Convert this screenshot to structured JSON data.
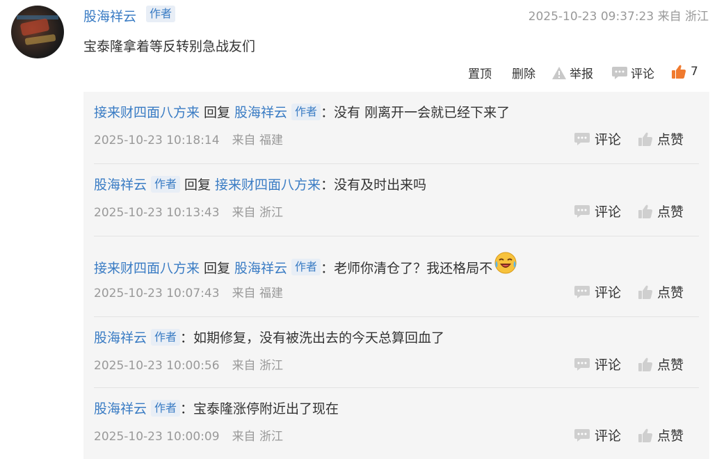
{
  "post": {
    "author": "股海祥云",
    "badge": "作者",
    "meta": "2025-10-23 09:37:23 来自 浙江",
    "text": "宝泰隆拿着等反转别急战友们",
    "actions": {
      "pin": "置顶",
      "delete": "删除",
      "report": "举报",
      "comment": "评论",
      "like_count": "7"
    }
  },
  "replies": [
    {
      "from": "接来财四面八方来",
      "reply_word": "回复",
      "to": "股海祥云",
      "to_badge": "作者",
      "text": "：没有 刚离开一会就已经下来了",
      "time": "2025-10-23 10:18:14",
      "location": "来自 福建",
      "comment": "评论",
      "like": "点赞"
    },
    {
      "from": "股海祥云",
      "from_badge": "作者",
      "reply_word": "回复",
      "to": "接来财四面八方来",
      "text": "：没有及时出来吗",
      "time": "2025-10-23 10:13:43",
      "location": "来自 浙江",
      "comment": "评论",
      "like": "点赞"
    },
    {
      "from": "接来财四面八方来",
      "reply_word": "回复",
      "to": "股海祥云",
      "to_badge": "作者",
      "text": "：老师你清仓了？我还格局不",
      "emoji": "laughing-crying-emoji",
      "time": "2025-10-23 10:07:43",
      "location": "来自 福建",
      "comment": "评论",
      "like": "点赞"
    },
    {
      "from": "股海祥云",
      "from_badge": "作者",
      "text": "：如期修复，没有被洗出去的今天总算回血了",
      "time": "2025-10-23 10:00:56",
      "location": "来自 浙江",
      "comment": "评论",
      "like": "点赞"
    },
    {
      "from": "股海祥云",
      "from_badge": "作者",
      "text": "：宝泰隆涨停附近出了现在",
      "time": "2025-10-23 10:00:09",
      "location": "来自 浙江",
      "comment": "评论",
      "like": "点赞"
    }
  ],
  "colors": {
    "link": "#3a7cc4",
    "like_active": "#f07a2e",
    "muted": "#999999",
    "panel_bg": "#f5f5f5"
  }
}
